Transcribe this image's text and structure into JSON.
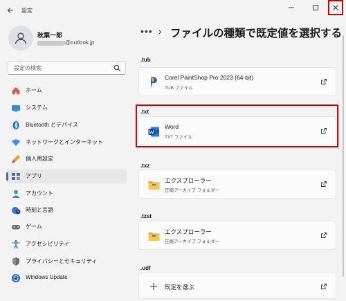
{
  "window": {
    "title": "設定",
    "back_icon": "back-arrow-icon",
    "minimize_icon": "minimize-icon",
    "maximize_icon": "maximize-icon",
    "close_icon": "close-icon",
    "close_highlight_color": "#d40000"
  },
  "user": {
    "name": "秋葉一郎",
    "email_suffix": "@outlook.jp"
  },
  "search": {
    "placeholder": "設定の検索"
  },
  "sidebar": {
    "items": [
      {
        "label": "ホーム",
        "icon": "home-icon"
      },
      {
        "label": "システム",
        "icon": "system-icon"
      },
      {
        "label": "Bluetooth とデバイス",
        "icon": "bluetooth-icon"
      },
      {
        "label": "ネットワークとインターネット",
        "icon": "wifi-icon"
      },
      {
        "label": "個人用設定",
        "icon": "brush-icon"
      },
      {
        "label": "アプリ",
        "icon": "apps-icon",
        "active": true
      },
      {
        "label": "アカウント",
        "icon": "account-icon"
      },
      {
        "label": "時刻と言語",
        "icon": "time-language-icon"
      },
      {
        "label": "ゲーム",
        "icon": "gamepad-icon"
      },
      {
        "label": "アクセシビリティ",
        "icon": "accessibility-icon"
      },
      {
        "label": "プライバシーとセキュリティ",
        "icon": "shield-icon"
      },
      {
        "label": "Windows Update",
        "icon": "update-icon"
      }
    ],
    "accent_color": "#2a6fd4"
  },
  "main": {
    "breadcrumb_ellipsis": "•••",
    "breadcrumb_separator": "›",
    "title": "ファイルの種類で既定値を選択する",
    "sections": [
      {
        "ext": ".tub",
        "app": "Corel PaintShop Pro 2023 (64-bit)",
        "desc": "TUB ファイル",
        "icon": "paintshop-icon"
      },
      {
        "ext": ".txt",
        "app": "Word",
        "desc": "TXT ファイル",
        "icon": "word-icon",
        "highlighted": true
      },
      {
        "ext": ".txz",
        "app": "エクスプローラー",
        "desc": "圧縮アーカイブ フォルダー",
        "icon": "folder-icon"
      },
      {
        "ext": ".tzst",
        "app": "エクスプローラー",
        "desc": "圧縮アーカイブ フォルダー",
        "icon": "folder-icon"
      },
      {
        "ext": ".udf",
        "app": "既定を選ぶ",
        "desc": "",
        "icon": "plus-icon"
      }
    ]
  }
}
